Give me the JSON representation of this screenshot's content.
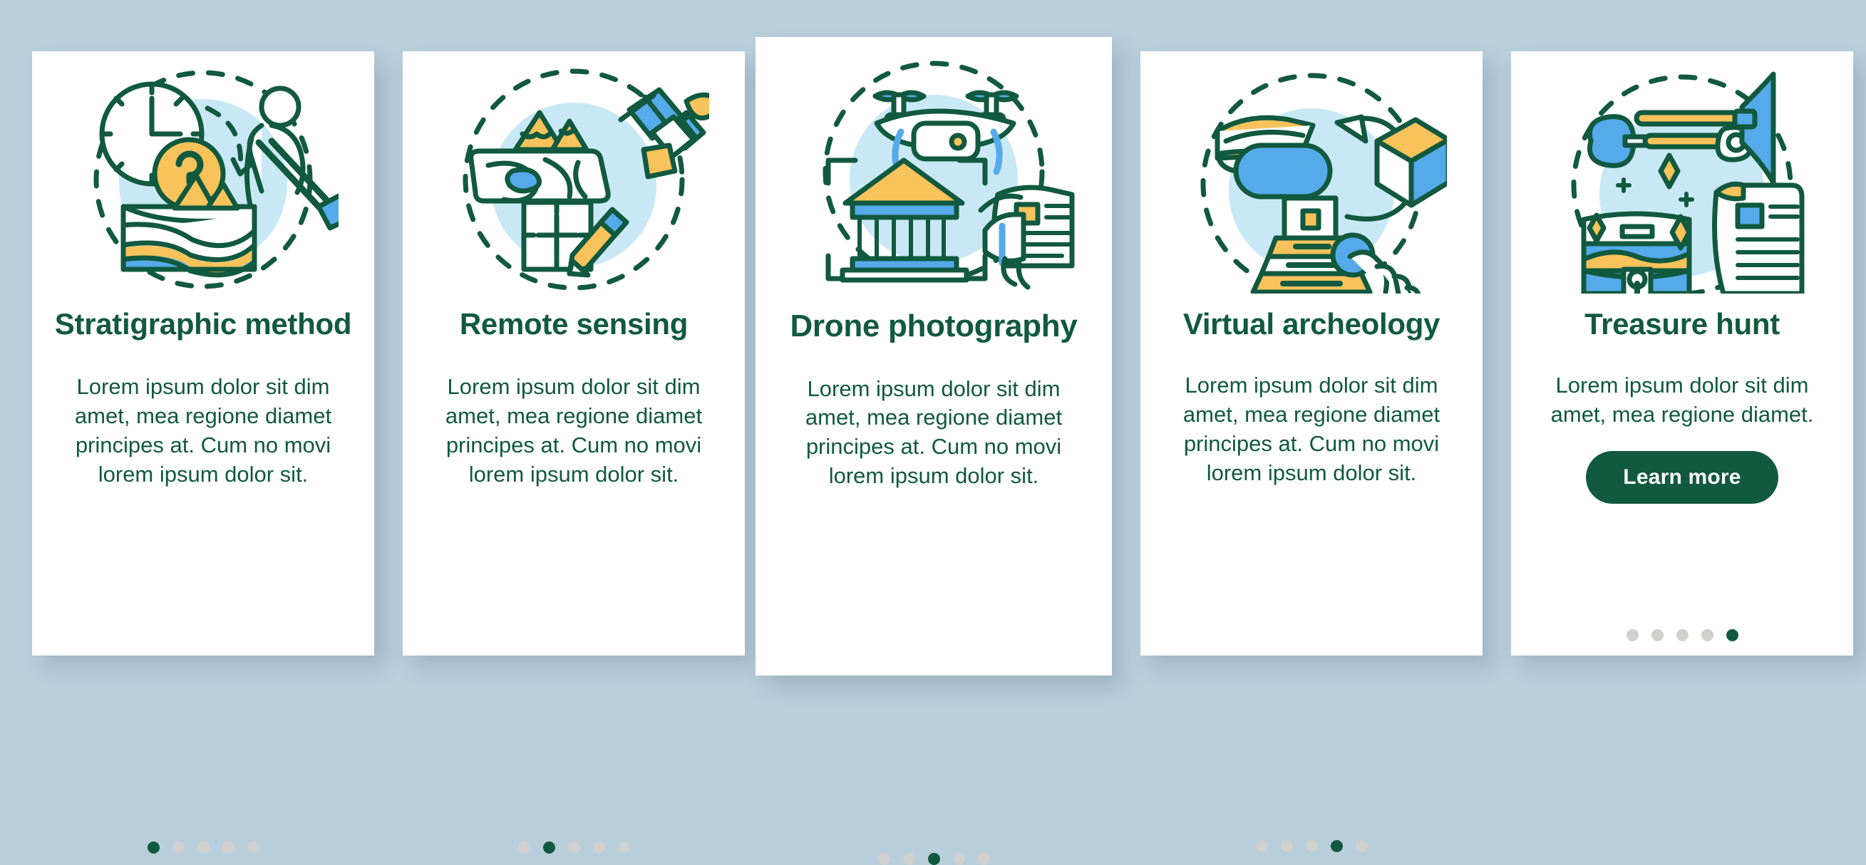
{
  "page": {
    "background_color": "#b9cedb",
    "accent_green": "#11593f",
    "dot_inactive_color": "#d0d0cf",
    "illustration_palette": {
      "outline": "#11593f",
      "yellow": "#f9c35b",
      "blue": "#55aaea",
      "pale_blue": "#c9e8f5",
      "white": "#ffffff"
    }
  },
  "cards": [
    {
      "id": "stratigraphic-method",
      "title": "Stratigraphic method",
      "body": "Lorem ipsum dolor sit dim amet, mea regione diamet principes at. Cum no movi lorem ipsum dolor sit.",
      "illustration_name": "clock-question-digger-strata",
      "dots": {
        "count": 5,
        "active_index": 0
      },
      "cta": null
    },
    {
      "id": "remote-sensing",
      "title": "Remote sensing",
      "body": "Lorem ipsum dolor sit dim amet, mea regione diamet principes at. Cum no movi lorem ipsum dolor sit.",
      "illustration_name": "terrain-satellite-map-pencil",
      "dots": {
        "count": 5,
        "active_index": 1
      },
      "cta": null
    },
    {
      "id": "drone-photography",
      "title": "Drone photography",
      "body": "Lorem ipsum dolor sit dim amet, mea regione diamet principes at. Cum no movi lorem ipsum dolor sit.",
      "illustration_name": "drone-temple-tablet",
      "dots": {
        "count": 5,
        "active_index": 2
      },
      "cta": null
    },
    {
      "id": "virtual-archeology",
      "title": "Virtual archeology",
      "body": "Lorem ipsum dolor sit dim amet, mea regione diamet principes at. Cum no movi lorem ipsum dolor sit.",
      "illustration_name": "vr-headset-cube-pyramid-hand",
      "dots": {
        "count": 5,
        "active_index": 3
      },
      "cta": null
    },
    {
      "id": "treasure-hunt",
      "title": "Treasure hunt",
      "body": "Lorem ipsum dolor sit dim amet, mea regione diamet.",
      "illustration_name": "shovel-pickaxe-chest-scroll",
      "dots": {
        "count": 5,
        "active_index": 4
      },
      "cta": {
        "label": "Learn more"
      }
    }
  ]
}
